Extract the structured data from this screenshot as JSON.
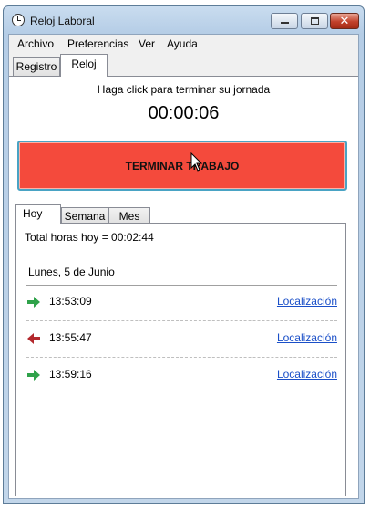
{
  "window": {
    "title": "Reloj Laboral"
  },
  "menu": [
    "Archivo",
    "Preferencias",
    "Ver",
    "Ayuda"
  ],
  "main_tabs": [
    {
      "label": "Registro",
      "active": false
    },
    {
      "label": "Reloj",
      "active": true
    }
  ],
  "clock": {
    "instruction": "Haga click para terminar su jornada",
    "elapsed": "00:00:06",
    "button_label": "TERMINAR TRABAJO",
    "button_color": "#f44a3c"
  },
  "sub_tabs": [
    {
      "label": "Hoy",
      "active": true
    },
    {
      "label": "Semana",
      "active": false
    },
    {
      "label": "Mes",
      "active": false
    }
  ],
  "today": {
    "total": "Total horas hoy = 00:02:44",
    "date": "Lunes, 5 de Junio",
    "entries": [
      {
        "time": "13:53:09",
        "direction": "in",
        "icon": "green-right-arrow-icon",
        "link": "Localización"
      },
      {
        "time": "13:55:47",
        "direction": "out",
        "icon": "red-left-arrow-icon",
        "link": "Localización"
      },
      {
        "time": "13:59:16",
        "direction": "in",
        "icon": "green-right-arrow-icon",
        "link": "Localización"
      }
    ]
  }
}
